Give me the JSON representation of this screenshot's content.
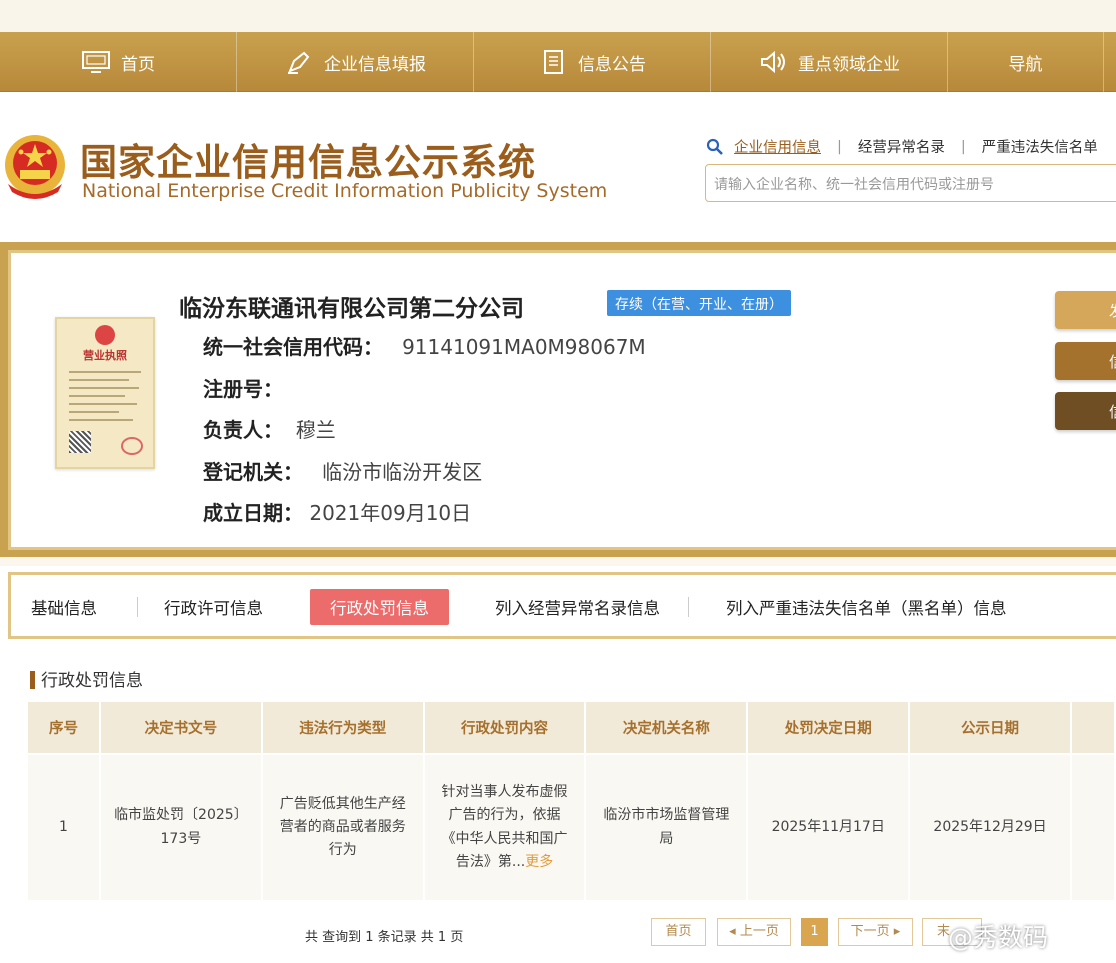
{
  "nav": {
    "items": [
      {
        "label": "首页",
        "icon": "monitor-icon"
      },
      {
        "label": "企业信息填报",
        "icon": "pen-icon"
      },
      {
        "label": "信息公告",
        "icon": "document-icon"
      },
      {
        "label": "重点领域企业",
        "icon": "speaker-icon"
      },
      {
        "label": "导航",
        "icon": ""
      }
    ]
  },
  "header": {
    "title_cn": "国家企业信用信息公示系统",
    "title_en": "National Enterprise Credit Information Publicity System",
    "search_tabs": [
      "企业信用信息",
      "经营异常名录",
      "严重违法失信名单"
    ],
    "search_placeholder": "请输入企业名称、统一社会信用代码或注册号"
  },
  "company": {
    "name": "临汾东联通讯有限公司第二分公司",
    "status": "存续（在营、开业、在册）",
    "license_title": "营业执照",
    "fields": [
      {
        "label": "统一社会信用代码：",
        "value": "91141091MA0M98067M"
      },
      {
        "label": "注册号：",
        "value": ""
      },
      {
        "label": "负责人：",
        "value": "穆兰"
      },
      {
        "label": "登记机关：",
        "value": "临汾市临汾开发区"
      },
      {
        "label": "成立日期：",
        "value": "2021年09月10日"
      }
    ],
    "side_buttons": [
      "发",
      "信",
      "信"
    ]
  },
  "tabs": [
    "基础信息",
    "行政许可信息",
    "行政处罚信息",
    "列入经营异常名录信息",
    "列入严重违法失信名单（黑名单）信息"
  ],
  "active_tab": "行政处罚信息",
  "section_title": "行政处罚信息",
  "table": {
    "headers": [
      "序号",
      "决定书文号",
      "违法行为类型",
      "行政处罚内容",
      "决定机关名称",
      "处罚决定日期",
      "公示日期"
    ],
    "row": {
      "index": "1",
      "doc_no": "临市监处罚〔2025〕173号",
      "violation": "广告贬低其他生产经营者的商品或者服务行为",
      "content": "针对当事人发布虚假广告的行为，依据《中华人民共和国广告法》第...",
      "more": "更多",
      "authority": "临汾市市场监督管理局",
      "decision_date": "2025年11月17日",
      "publish_date": "2025年12月29日"
    }
  },
  "pager": {
    "total": "共 查询到 1 条记录 共 1 页",
    "first": "首页",
    "prev": "上一页",
    "current": "1",
    "next": "下一页",
    "last": "末"
  },
  "watermark": "@秀数码"
}
